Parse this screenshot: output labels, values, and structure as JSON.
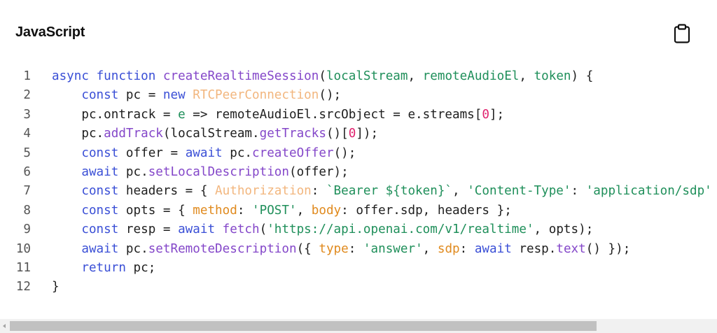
{
  "header": {
    "title": "JavaScript",
    "copy_icon": "clipboard-icon"
  },
  "code": {
    "lines": [
      {
        "n": "1",
        "tokens": [
          [
            "kw",
            "async"
          ],
          [
            "pl",
            " "
          ],
          [
            "kw",
            "function"
          ],
          [
            "pl",
            " "
          ],
          [
            "fn",
            "createRealtimeSession"
          ],
          [
            "pl",
            "("
          ],
          [
            "pm",
            "localStream"
          ],
          [
            "pl",
            ", "
          ],
          [
            "pm",
            "remoteAudioEl"
          ],
          [
            "pl",
            ", "
          ],
          [
            "pm",
            "token"
          ],
          [
            "pl",
            ") {"
          ]
        ]
      },
      {
        "n": "2",
        "tokens": [
          [
            "pl",
            "    "
          ],
          [
            "kw",
            "const"
          ],
          [
            "pl",
            " pc = "
          ],
          [
            "kw",
            "new"
          ],
          [
            "pl",
            " "
          ],
          [
            "cl",
            "RTCPeerConnection"
          ],
          [
            "pl",
            "();"
          ]
        ]
      },
      {
        "n": "3",
        "tokens": [
          [
            "pl",
            "    pc.ontrack = "
          ],
          [
            "pm",
            "e"
          ],
          [
            "pl",
            " => remoteAudioEl.srcObject = e.streams["
          ],
          [
            "num",
            "0"
          ],
          [
            "pl",
            "];"
          ]
        ]
      },
      {
        "n": "4",
        "tokens": [
          [
            "pl",
            "    pc."
          ],
          [
            "fn",
            "addTrack"
          ],
          [
            "pl",
            "(localStream."
          ],
          [
            "fn",
            "getTracks"
          ],
          [
            "pl",
            "()["
          ],
          [
            "num",
            "0"
          ],
          [
            "pl",
            "]);"
          ]
        ]
      },
      {
        "n": "5",
        "tokens": [
          [
            "pl",
            "    "
          ],
          [
            "kw",
            "const"
          ],
          [
            "pl",
            " offer = "
          ],
          [
            "kw",
            "await"
          ],
          [
            "pl",
            " pc."
          ],
          [
            "fn",
            "createOffer"
          ],
          [
            "pl",
            "();"
          ]
        ]
      },
      {
        "n": "6",
        "tokens": [
          [
            "pl",
            "    "
          ],
          [
            "kw",
            "await"
          ],
          [
            "pl",
            " pc."
          ],
          [
            "fn",
            "setLocalDescription"
          ],
          [
            "pl",
            "(offer);"
          ]
        ]
      },
      {
        "n": "7",
        "tokens": [
          [
            "pl",
            "    "
          ],
          [
            "kw",
            "const"
          ],
          [
            "pl",
            " headers = { "
          ],
          [
            "cl",
            "Authorization"
          ],
          [
            "pl",
            ": "
          ],
          [
            "str",
            "`Bearer ${token}`"
          ],
          [
            "pl",
            ", "
          ],
          [
            "str",
            "'Content-Type'"
          ],
          [
            "pl",
            ": "
          ],
          [
            "str",
            "'application/sdp'"
          ],
          [
            "pl",
            " };"
          ]
        ]
      },
      {
        "n": "8",
        "tokens": [
          [
            "pl",
            "    "
          ],
          [
            "kw",
            "const"
          ],
          [
            "pl",
            " opts = { "
          ],
          [
            "prop",
            "method"
          ],
          [
            "pl",
            ": "
          ],
          [
            "str",
            "'POST'"
          ],
          [
            "pl",
            ", "
          ],
          [
            "prop",
            "body"
          ],
          [
            "pl",
            ": offer.sdp, headers };"
          ]
        ]
      },
      {
        "n": "9",
        "tokens": [
          [
            "pl",
            "    "
          ],
          [
            "kw",
            "const"
          ],
          [
            "pl",
            " resp = "
          ],
          [
            "kw",
            "await"
          ],
          [
            "pl",
            " "
          ],
          [
            "fn",
            "fetch"
          ],
          [
            "pl",
            "("
          ],
          [
            "str",
            "'https://api.openai.com/v1/realtime'"
          ],
          [
            "pl",
            ", opts);"
          ]
        ]
      },
      {
        "n": "10",
        "tokens": [
          [
            "pl",
            "    "
          ],
          [
            "kw",
            "await"
          ],
          [
            "pl",
            " pc."
          ],
          [
            "fn",
            "setRemoteDescription"
          ],
          [
            "pl",
            "({ "
          ],
          [
            "prop",
            "type"
          ],
          [
            "pl",
            ": "
          ],
          [
            "str",
            "'answer'"
          ],
          [
            "pl",
            ", "
          ],
          [
            "prop",
            "sdp"
          ],
          [
            "pl",
            ": "
          ],
          [
            "kw",
            "await"
          ],
          [
            "pl",
            " resp."
          ],
          [
            "fn",
            "text"
          ],
          [
            "pl",
            "() });"
          ]
        ]
      },
      {
        "n": "11",
        "tokens": [
          [
            "pl",
            "    "
          ],
          [
            "kw",
            "return"
          ],
          [
            "pl",
            " pc;"
          ]
        ]
      },
      {
        "n": "12",
        "tokens": [
          [
            "pl",
            "}"
          ]
        ]
      }
    ]
  },
  "scrollbar": {
    "left_arrow_icon": "scroll-left-arrow-icon",
    "thumb_fraction": 0.83
  }
}
